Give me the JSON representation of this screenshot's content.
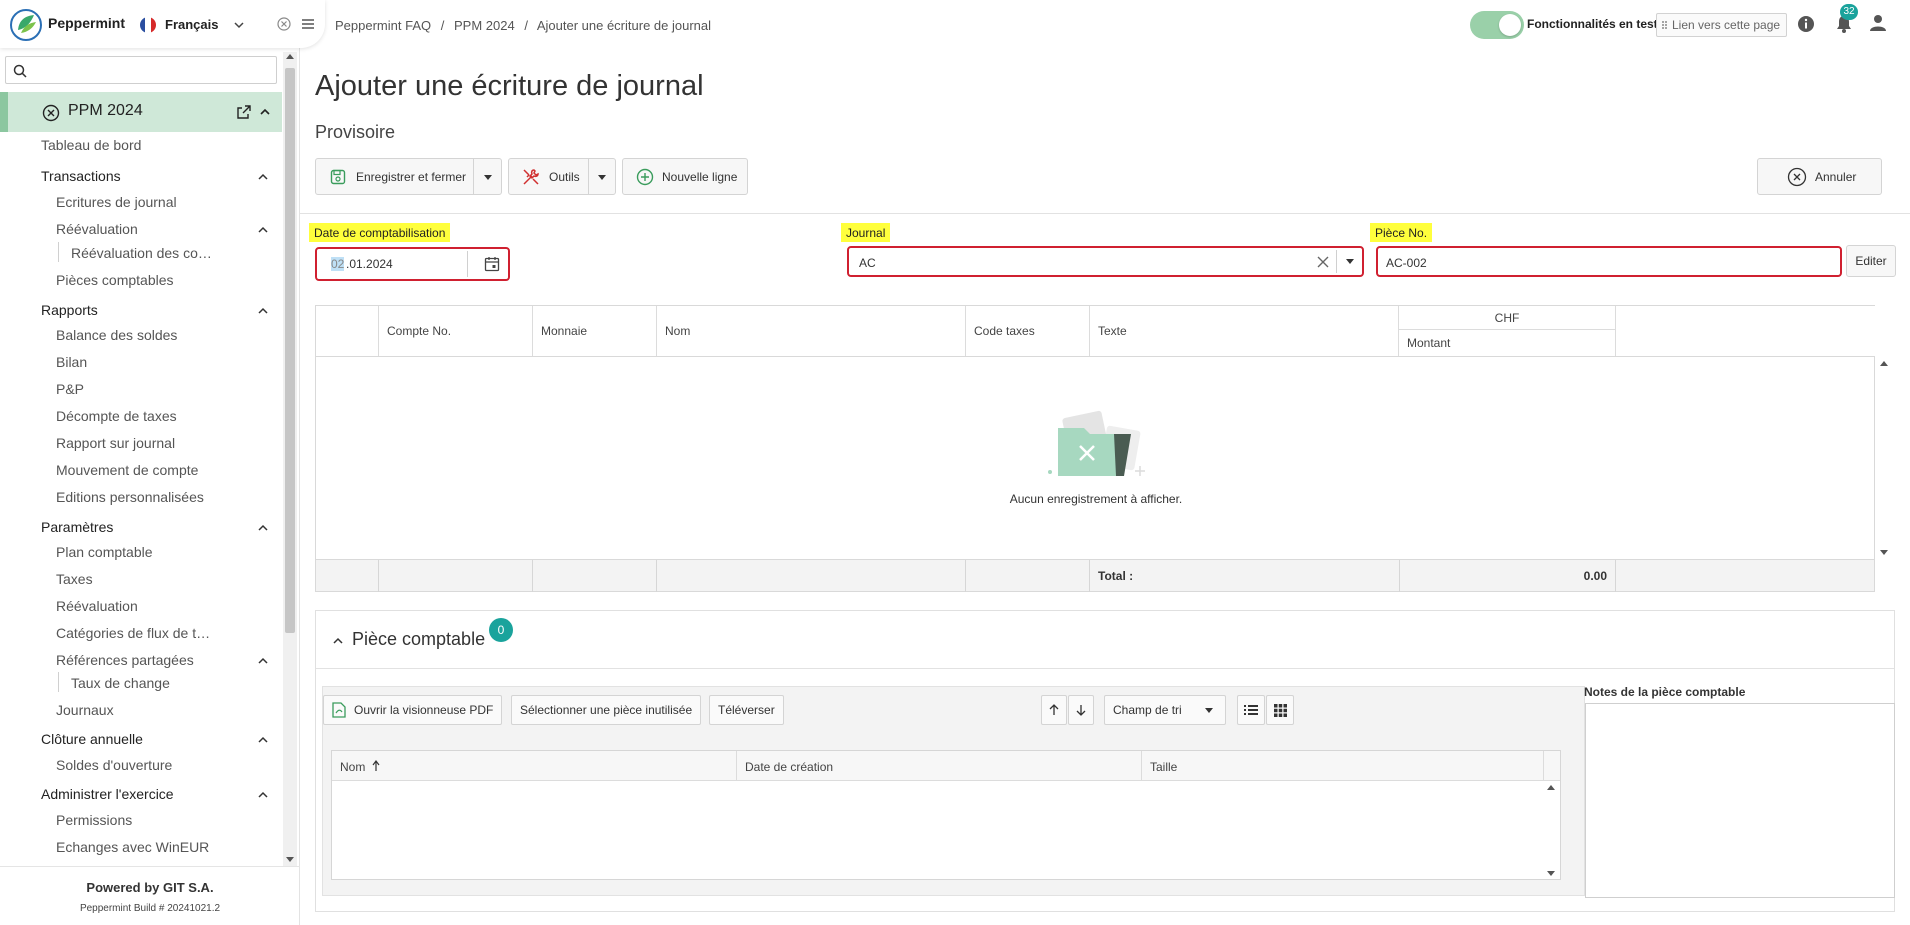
{
  "brand": {
    "name": "Peppermint"
  },
  "language": {
    "label": "Français"
  },
  "search": {
    "placeholder": ""
  },
  "project": {
    "title": "PPM 2024"
  },
  "nav": {
    "dashboard": "Tableau de bord",
    "transactions": {
      "label": "Transactions",
      "journal_entries": "Ecritures de journal",
      "revaluation": "Réévaluation",
      "revaluation_child": "Réévaluation des co…",
      "vouchers": "Pièces comptables"
    },
    "reports": {
      "label": "Rapports",
      "items": [
        "Balance des soldes",
        "Bilan",
        "P&P",
        "Décompte de taxes",
        "Rapport sur journal",
        "Mouvement de compte",
        "Editions personnalisées"
      ]
    },
    "settings": {
      "label": "Paramètres",
      "chart": "Plan comptable",
      "taxes": "Taxes",
      "revaluation": "Réévaluation",
      "cashflow": "Catégories de flux de t…",
      "shared_refs": "Références partagées",
      "exchange": "Taux de change",
      "journals": "Journaux"
    },
    "closing": {
      "label": "Clôture annuelle",
      "opening": "Soldes d'ouverture"
    },
    "admin": {
      "label": "Administrer l'exercice",
      "permissions": "Permissions",
      "winEUR": "Echanges avec WinEUR"
    }
  },
  "footer": {
    "powered": "Powered by GIT S.A.",
    "build": "Peppermint Build # 20241021.2"
  },
  "breadcrumb": [
    "Peppermint FAQ",
    "/",
    "PPM 2024",
    "/",
    "Ajouter une écriture de journal"
  ],
  "topbar": {
    "beta_label": "Fonctionnalités en test",
    "beta_enabled": true,
    "link_label": "Lien vers cette page",
    "notifications": "32"
  },
  "page": {
    "title": "Ajouter une écriture de journal",
    "status": "Provisoire"
  },
  "toolbar": {
    "save_close": "Enregistrer et fermer",
    "tools": "Outils",
    "new_line": "Nouvelle ligne",
    "cancel": "Annuler"
  },
  "form": {
    "date_label": "Date de comptabilisation",
    "date_day": "02",
    "date_rest": ".01.2024",
    "journal_label": "Journal",
    "journal_value": "AC",
    "piece_label": "Pièce No.",
    "piece_value": "AC-002",
    "edit_button": "Editer"
  },
  "grid": {
    "columns": [
      "Compte No.",
      "Monnaie",
      "Nom",
      "Code taxes",
      "Texte"
    ],
    "currency_group": "CHF",
    "amount_col": "Montant",
    "empty_text": "Aucun enregistrement à afficher.",
    "total_label": "Total :",
    "total_value": "0.00"
  },
  "attachments": {
    "title": "Pièce comptable",
    "count": "0",
    "open_pdf": "Ouvrir la visionneuse PDF",
    "select_unused": "Sélectionner une pièce inutilisée",
    "upload": "Téléverser",
    "sort_field": "Champ de tri",
    "columns": [
      "Nom",
      "Date de création",
      "Taille"
    ],
    "notes_label": "Notes de la pièce comptable"
  },
  "colors": {
    "accent": "#1aa39c",
    "highlight": "#ffff3c",
    "error_border": "#d02030",
    "project_bg": "#cfe8d8"
  }
}
